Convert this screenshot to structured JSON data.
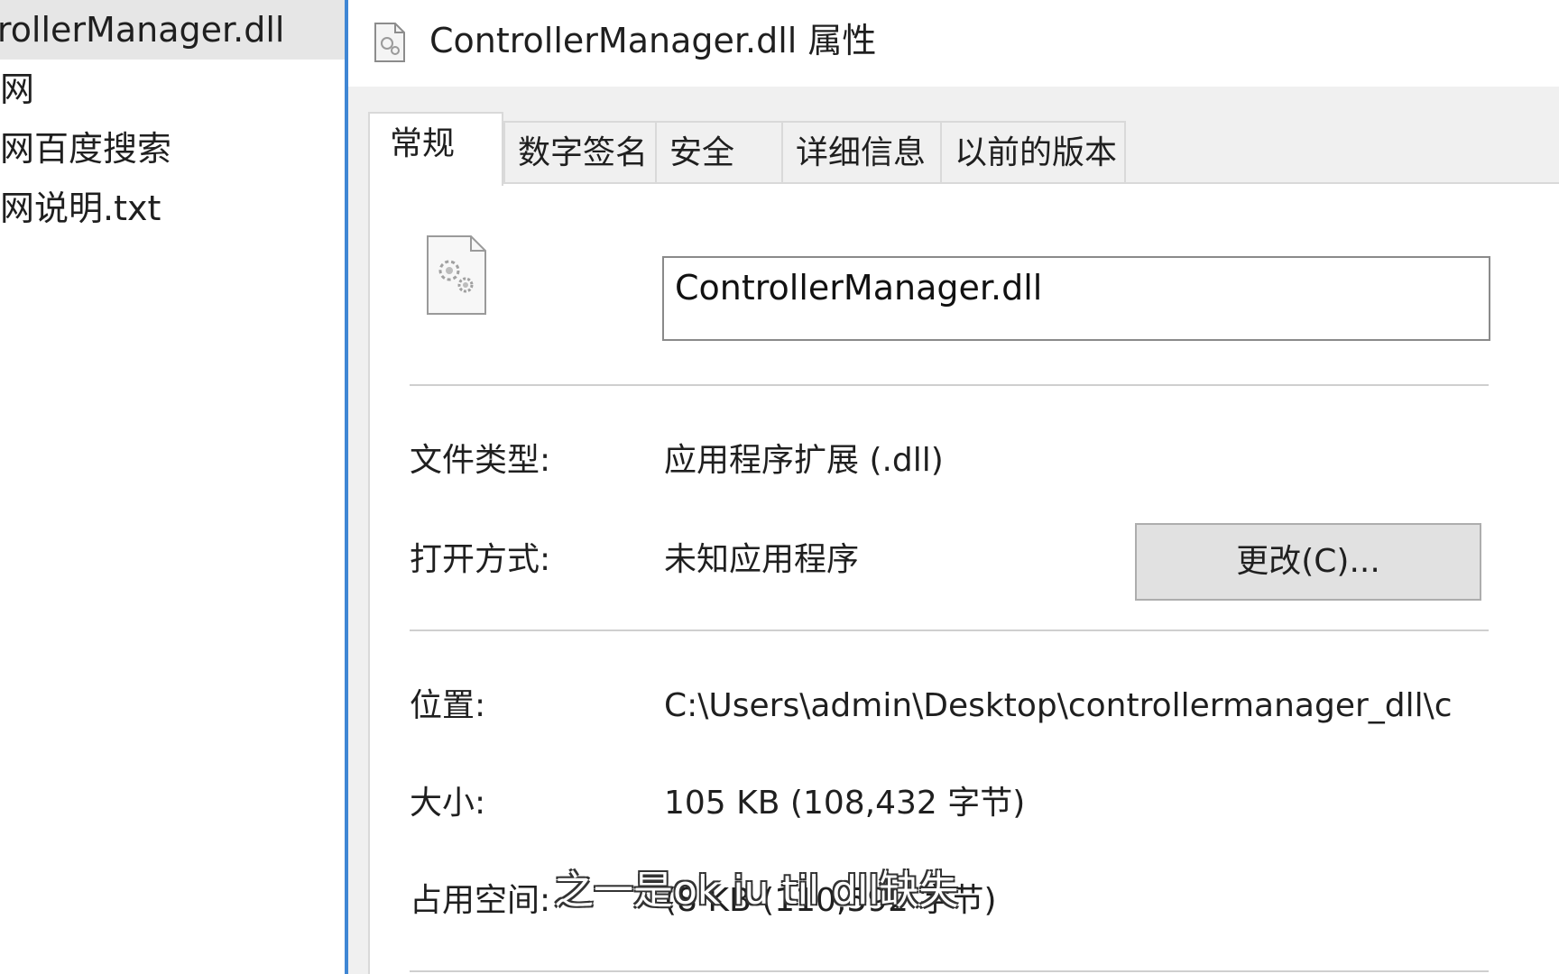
{
  "explorer": {
    "items": [
      {
        "label": "trollerManager.dll"
      },
      {
        "label": "网"
      },
      {
        "label": "网百度搜索"
      },
      {
        "label": "网说明.txt"
      }
    ]
  },
  "dialog": {
    "title": "ControllerManager.dll 属性",
    "tabs": [
      {
        "label": "常规"
      },
      {
        "label": "数字签名"
      },
      {
        "label": "安全"
      },
      {
        "label": "详细信息"
      },
      {
        "label": "以前的版本"
      }
    ],
    "file_name": "ControllerManager.dll",
    "file_type_label": "文件类型:",
    "file_type_value": "应用程序扩展 (.dll)",
    "open_with_label": "打开方式:",
    "open_with_value": "未知应用程序",
    "change_button": "更改(C)...",
    "location_label": "位置:",
    "location_value": "C:\\Users\\admin\\Desktop\\controllermanager_dll\\c",
    "size_label": "大小:",
    "size_value": "105 KB (108,432 字节)",
    "disk_size_label": "占用空间:",
    "disk_size_value": "(8 KB (110,592 字节)"
  },
  "subtitle": "之一是ok iu til dll缺失",
  "colors": {
    "accent": "#3f86d4",
    "tab_bg": "#f0f0f0",
    "button_bg": "#e1e1e1"
  }
}
